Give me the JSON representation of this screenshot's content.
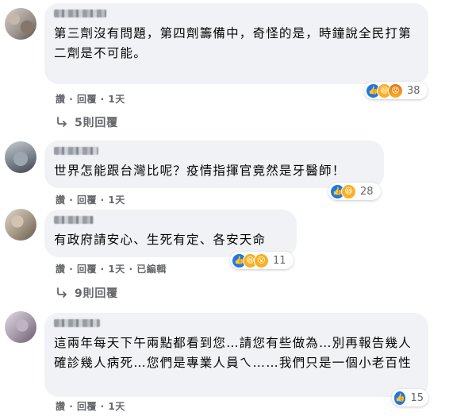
{
  "comments": [
    {
      "text": "第三劑沒有問題，第四劑籌備中，奇怪的是，時鐘說全民打第二劑是不可能。",
      "reaction_count": "38",
      "reactions": [
        "like-icon",
        "haha-icon",
        "angry-icon"
      ],
      "like": "讚",
      "reply": "回覆",
      "time": "1天",
      "edited": "",
      "replies": "5則回覆"
    },
    {
      "text": "世界怎能跟台灣比呢？疫情指揮官竟然是牙醫師！",
      "reaction_count": "28",
      "reactions": [
        "like-icon",
        "haha-icon"
      ],
      "like": "讚",
      "reply": "回覆",
      "time": "1天",
      "edited": "",
      "replies": ""
    },
    {
      "text": "有政府請安心、生死有定、各安天命",
      "reaction_count": "11",
      "reactions": [
        "like-icon",
        "haha-icon",
        "wow-icon"
      ],
      "like": "讚",
      "reply": "回覆",
      "time": "1天",
      "edited": "已編輯",
      "replies": "9則回覆"
    },
    {
      "text": "這兩年每天下午兩點都看到您…請您有些做為…別再報告幾人確診幾人病死…您們是專業人員ㄟ……我們只是一個小老百性",
      "reaction_count": "15",
      "reactions": [
        "like-icon"
      ],
      "like": "讚",
      "reply": "回覆",
      "time": "1天",
      "edited": "",
      "replies": ""
    }
  ],
  "separator": "·",
  "colors": {
    "bubble": "#f0f2f5",
    "meta": "#65676b",
    "like": "#1877f2",
    "haha": "#f7b125"
  }
}
